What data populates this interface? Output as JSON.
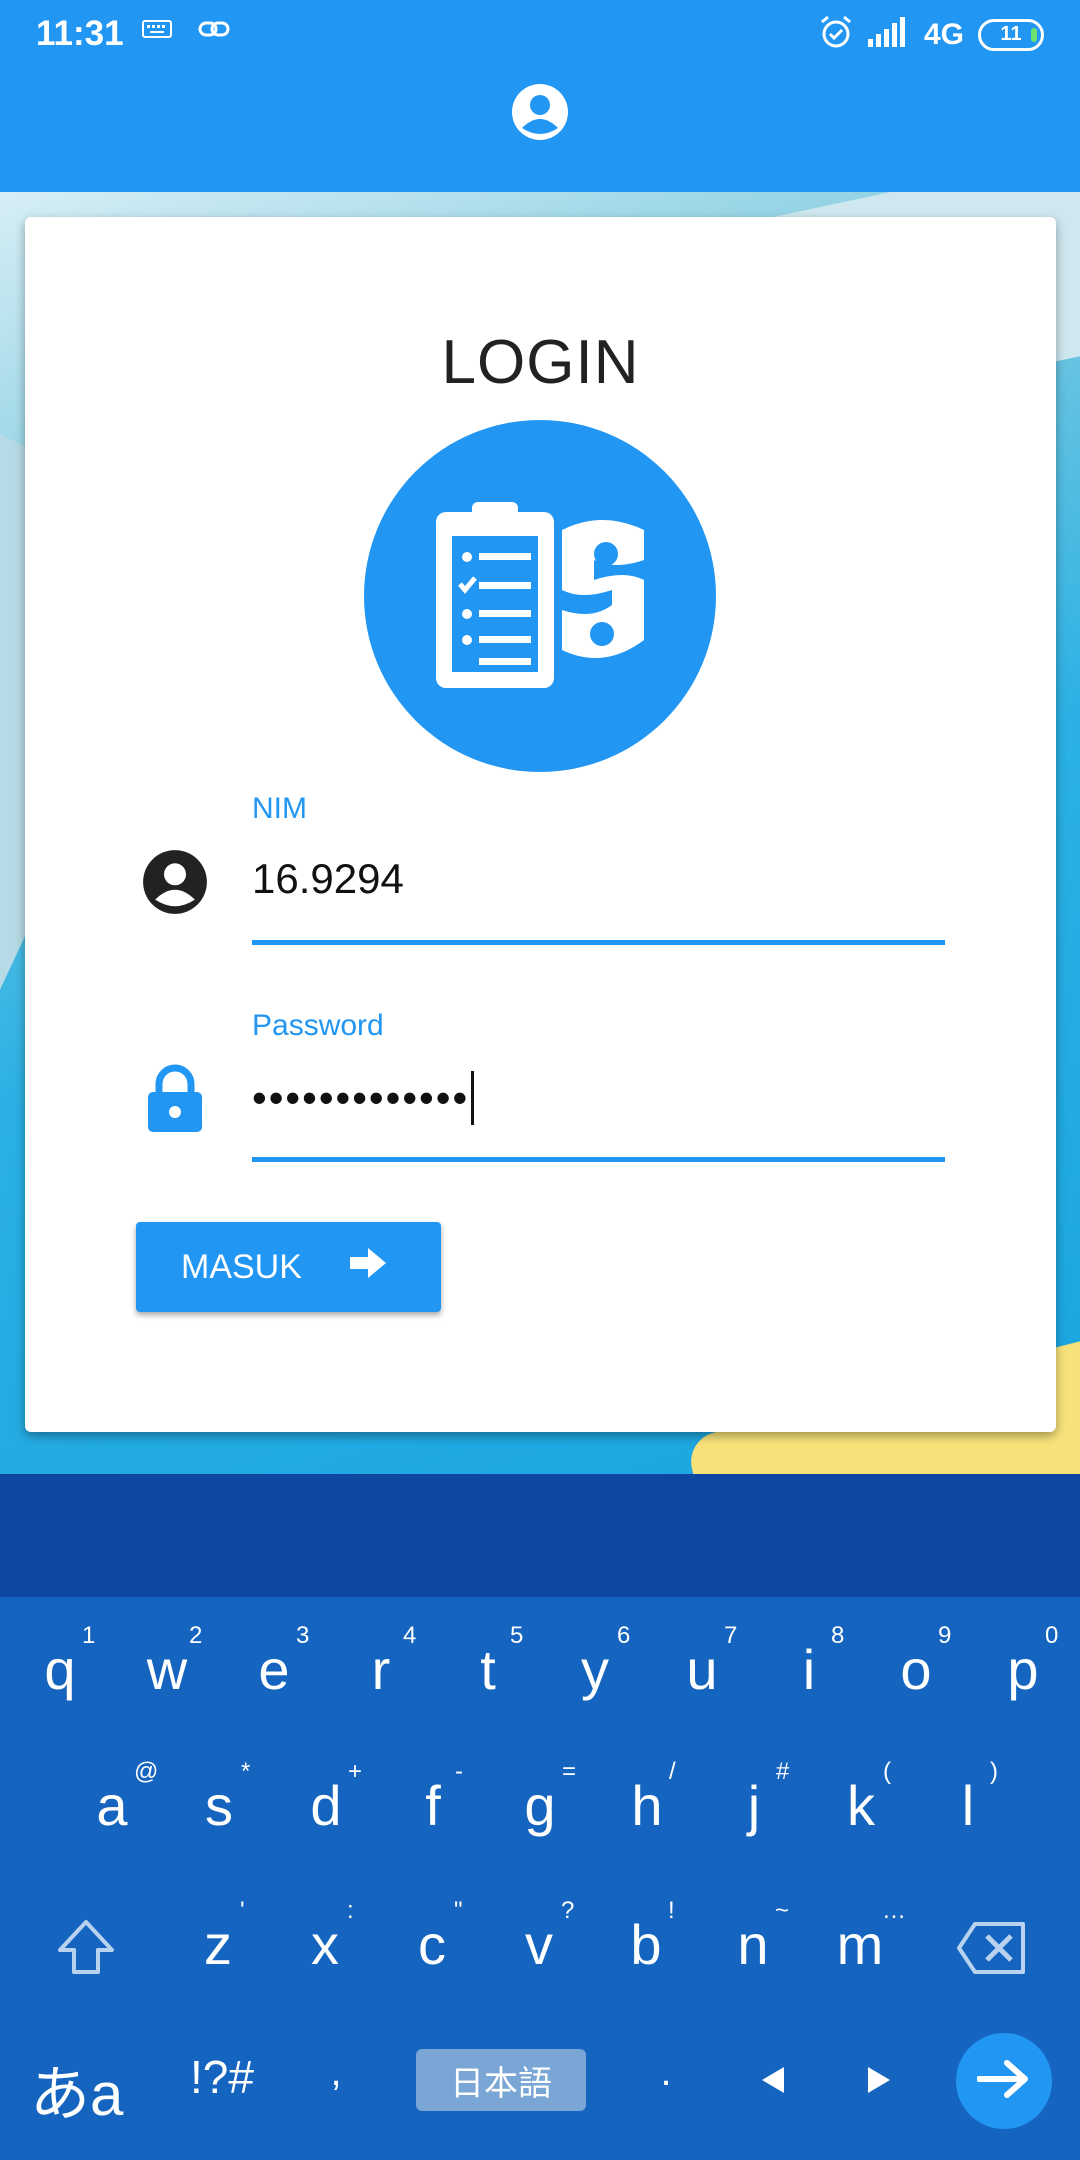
{
  "status_bar": {
    "time": "11:31",
    "network": "4G",
    "battery": "11",
    "icons": [
      "keyboard-icon",
      "link-icon",
      "alarm-icon",
      "signal-icon",
      "battery-icon"
    ]
  },
  "app_bar": {
    "icon": "account-circle-icon"
  },
  "login": {
    "title": "LOGIN",
    "logo_icon": "clipboard-checklist-logo-icon",
    "nim": {
      "label": "NIM",
      "value": "16.9294",
      "icon": "account-circle-icon"
    },
    "password": {
      "label": "Password",
      "value": "•••••••••••••",
      "icon": "lock-icon"
    },
    "submit": {
      "label": "MASUK",
      "icon": "arrow-right-icon"
    }
  },
  "keyboard": {
    "row1": [
      {
        "k": "q",
        "h": "1"
      },
      {
        "k": "w",
        "h": "2"
      },
      {
        "k": "e",
        "h": "3"
      },
      {
        "k": "r",
        "h": "4"
      },
      {
        "k": "t",
        "h": "5"
      },
      {
        "k": "y",
        "h": "6"
      },
      {
        "k": "u",
        "h": "7"
      },
      {
        "k": "i",
        "h": "8"
      },
      {
        "k": "o",
        "h": "9"
      },
      {
        "k": "p",
        "h": "0"
      }
    ],
    "row2": [
      {
        "k": "a",
        "h": "@"
      },
      {
        "k": "s",
        "h": "*"
      },
      {
        "k": "d",
        "h": "+"
      },
      {
        "k": "f",
        "h": "-"
      },
      {
        "k": "g",
        "h": "="
      },
      {
        "k": "h",
        "h": "/"
      },
      {
        "k": "j",
        "h": "#"
      },
      {
        "k": "k",
        "h": "("
      },
      {
        "k": "l",
        "h": ")"
      }
    ],
    "row3": [
      {
        "k": "z",
        "h": "'"
      },
      {
        "k": "x",
        "h": ":"
      },
      {
        "k": "c",
        "h": "\""
      },
      {
        "k": "v",
        "h": "?"
      },
      {
        "k": "b",
        "h": "!"
      },
      {
        "k": "n",
        "h": "~"
      },
      {
        "k": "m",
        "h": "…"
      }
    ],
    "symbols_key": "!?#",
    "kana_key": "あa",
    "comma": ",",
    "period": ".",
    "language_key": "日本語",
    "colors": {
      "background": "#1565c0",
      "toolbar": "#0d47a1",
      "enter": "#2196f3"
    }
  },
  "colors": {
    "primary": "#2196f3",
    "text": "#222222"
  }
}
